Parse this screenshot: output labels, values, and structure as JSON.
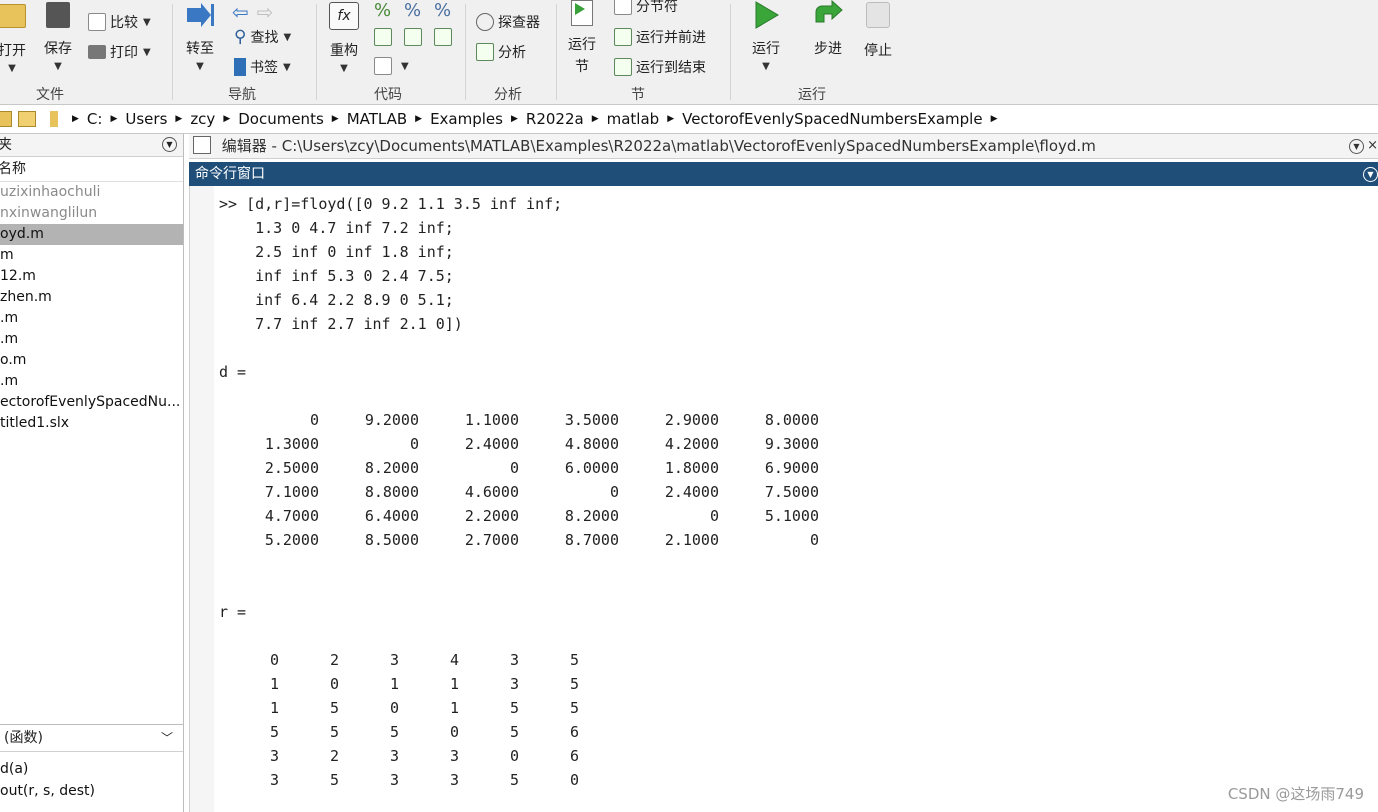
{
  "ribbon": {
    "file_group": {
      "open": "打开",
      "save": "保存",
      "compare": "比较",
      "print": "打印",
      "label": "文件"
    },
    "nav_group": {
      "goto": "转至",
      "find": "查找",
      "bookmark": "书签",
      "label": "导航"
    },
    "code_group": {
      "refactor": "重构",
      "label": "代码"
    },
    "analysis_group": {
      "explorer": "探查器",
      "analyze": "分析",
      "label": "分析"
    },
    "section_group": {
      "run_section": "运行节",
      "run_section_l1": "运行",
      "run_section_l2": "节",
      "section_break": "分节符",
      "run_advance": "运行并前进",
      "run_to_end": "运行到结束",
      "label": "节"
    },
    "run_group": {
      "run": "运行",
      "step": "步进",
      "stop": "停止",
      "label": "运行"
    }
  },
  "address": [
    "C:",
    "Users",
    "zcy",
    "Documents",
    "MATLAB",
    "Examples",
    "R2022a",
    "matlab",
    "VectorofEvenlySpacedNumbersExample"
  ],
  "left_panel": {
    "header": "夹",
    "column_name": "名称",
    "files": [
      {
        "name": "uzixinhaochuli",
        "dim": true,
        "selected": false
      },
      {
        "name": "nxinwanglilun",
        "dim": true,
        "selected": false
      },
      {
        "name": "oyd.m",
        "dim": false,
        "selected": true
      },
      {
        "name": "m",
        "dim": false,
        "selected": false
      },
      {
        "name": "12.m",
        "dim": false,
        "selected": false
      },
      {
        "name": "zhen.m",
        "dim": false,
        "selected": false
      },
      {
        "name": ".m",
        "dim": false,
        "selected": false
      },
      {
        "name": ".m",
        "dim": false,
        "selected": false
      },
      {
        "name": "o.m",
        "dim": false,
        "selected": false
      },
      {
        "name": ".m",
        "dim": false,
        "selected": false
      },
      {
        "name": "ectorofEvenlySpacedNu...",
        "dim": false,
        "selected": false
      },
      {
        "name": "titled1.slx",
        "dim": false,
        "selected": false
      }
    ],
    "detail_header": "(函数)",
    "functions": [
      "d(a)",
      "out(r, s, dest)"
    ]
  },
  "editor_title": "编辑器 - C:\\Users\\zcy\\Documents\\MATLAB\\Examples\\R2022a\\matlab\\VectorofEvenlySpacedNumbersExample\\floyd.m",
  "command_window": {
    "title": "命令行窗口",
    "input_lines": [
      ">> [d,r]=floyd([0 9.2 1.1 3.5 inf inf;",
      "    1.3 0 4.7 inf 7.2 inf;",
      "    2.5 inf 0 inf 1.8 inf;",
      "    inf inf 5.3 0 2.4 7.5;",
      "    inf 6.4 2.2 8.9 0 5.1;",
      "    7.7 inf 2.7 inf 2.1 0])"
    ],
    "d_label": "d =",
    "d_rows": [
      [
        "0",
        "9.2000",
        "1.1000",
        "3.5000",
        "2.9000",
        "8.0000"
      ],
      [
        "1.3000",
        "0",
        "2.4000",
        "4.8000",
        "4.2000",
        "9.3000"
      ],
      [
        "2.5000",
        "8.2000",
        "0",
        "6.0000",
        "1.8000",
        "6.9000"
      ],
      [
        "7.1000",
        "8.8000",
        "4.6000",
        "0",
        "2.4000",
        "7.5000"
      ],
      [
        "4.7000",
        "6.4000",
        "2.2000",
        "8.2000",
        "0",
        "5.1000"
      ],
      [
        "5.2000",
        "8.5000",
        "2.7000",
        "8.7000",
        "2.1000",
        "0"
      ]
    ],
    "r_label": "r =",
    "r_rows": [
      [
        "0",
        "2",
        "3",
        "4",
        "3",
        "5"
      ],
      [
        "1",
        "0",
        "1",
        "1",
        "3",
        "5"
      ],
      [
        "1",
        "5",
        "0",
        "1",
        "5",
        "5"
      ],
      [
        "5",
        "5",
        "5",
        "0",
        "5",
        "6"
      ],
      [
        "3",
        "2",
        "3",
        "3",
        "0",
        "6"
      ],
      [
        "3",
        "5",
        "3",
        "3",
        "5",
        "0"
      ]
    ]
  },
  "watermark": "CSDN @这场雨749"
}
